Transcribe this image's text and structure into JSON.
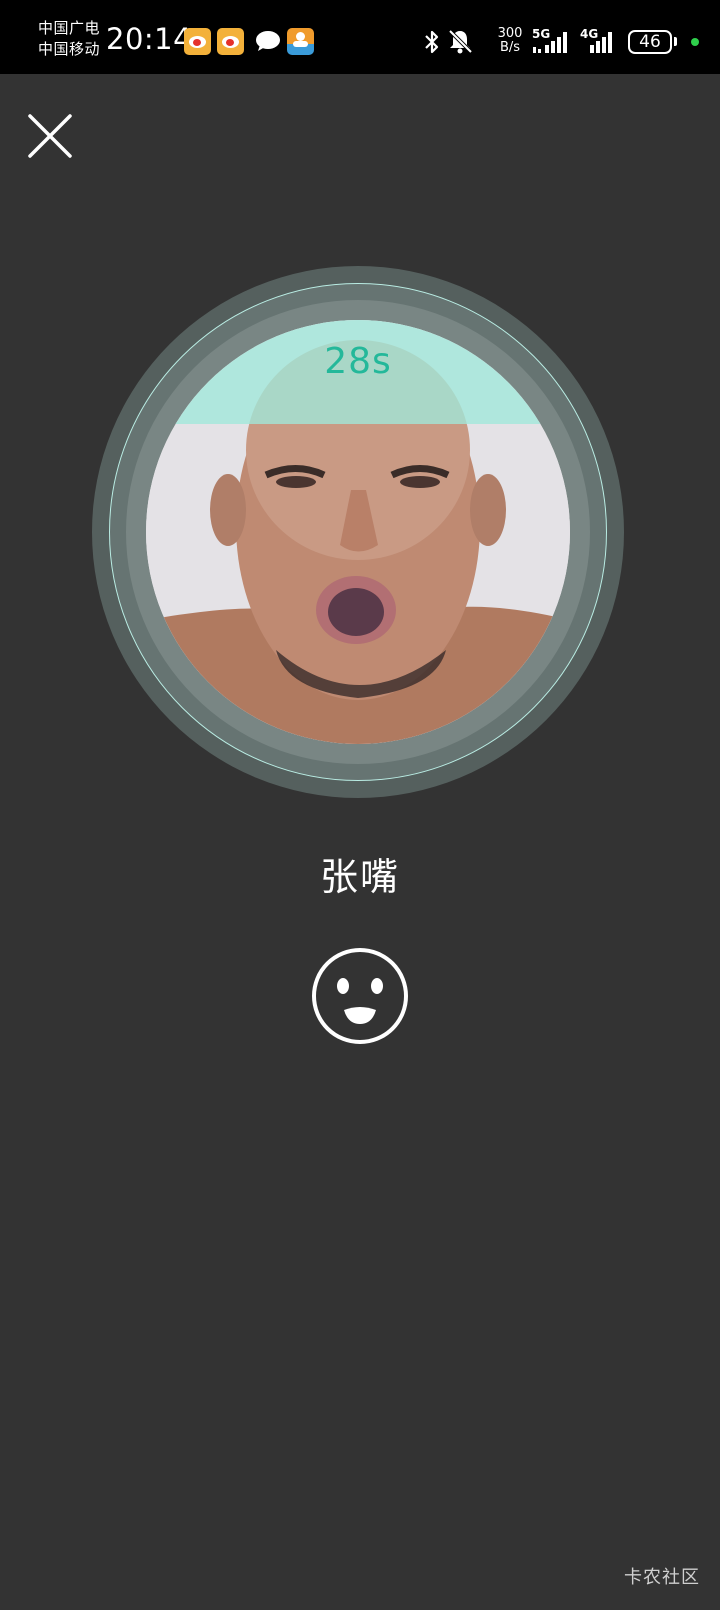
{
  "status_bar": {
    "carrier_1": "中国广电",
    "carrier_2": "中国移动",
    "time": "20:14",
    "notification_icons": [
      "weibo-icon",
      "weibo-icon",
      "chat-bubble-icon",
      "game-app-icon"
    ],
    "bluetooth_icon": "bluetooth-icon",
    "mute_icon": "bell-muted-icon",
    "net_speed_value": "300",
    "net_speed_unit": "B/s",
    "signal_1_label": "5G",
    "signal_2_label": "4G",
    "battery": "46",
    "indicator_color": "#2fcf4c"
  },
  "close_icon": "close-icon",
  "face_capture": {
    "countdown": "28s",
    "band_color": "#a0e8da",
    "countdown_color": "#24b89a"
  },
  "instruction": {
    "text": "张嘴",
    "icon": "smiley-open-mouth-icon"
  },
  "watermark": "卡农社区",
  "colors": {
    "background": "#333333",
    "status_bar": "#000000"
  }
}
